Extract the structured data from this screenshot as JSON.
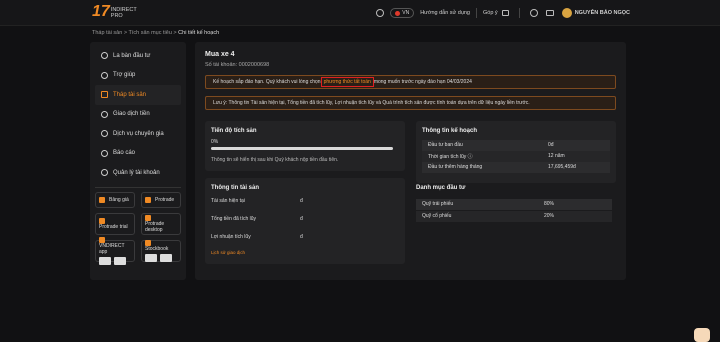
{
  "topbar": {
    "logo_mark": "17",
    "logo_line1": "INDIRECT",
    "logo_line2": "PRO",
    "help_label": "Hướng dẫn sử dụng",
    "language": "VN",
    "feedback_label": "Góp ý",
    "user_name": "NGUYỄN BẢO NGỌC"
  },
  "breadcrumb": {
    "items": [
      "Tháp tài sản",
      "Tích sản mục tiêu"
    ],
    "current": "Chi tiết kế hoạch",
    "separator": ">"
  },
  "sidebar": {
    "items": [
      {
        "label": "La bàn đầu tư",
        "icon": "compass-icon"
      },
      {
        "label": "Trợ giúp",
        "icon": "help-icon"
      },
      {
        "label": "Tháp tài sản",
        "icon": "tower-icon",
        "active": true
      },
      {
        "label": "Giao dịch tiền",
        "icon": "money-icon"
      },
      {
        "label": "Dịch vụ chuyên gia",
        "icon": "expert-icon"
      },
      {
        "label": "Báo cáo",
        "icon": "report-icon"
      },
      {
        "label": "Quản lý tài khoản",
        "icon": "account-icon"
      }
    ],
    "platforms": [
      {
        "label": "Bảng giá"
      },
      {
        "label": "Protrade"
      },
      {
        "label": "Protrade trial"
      },
      {
        "label": "Protrade desktop"
      },
      {
        "label": "VNDIRECT app"
      },
      {
        "label": "Stockbook"
      }
    ]
  },
  "plan": {
    "title": "Mua xe 4",
    "account": "Số tài khoản: 0002000698",
    "alert1_pre": "Kế hoạch sắp đáo hạn. Quý khách vui lòng chọn ",
    "alert1_link": "phương thức tất toán",
    "alert1_post": " mong muốn trước ngày đáo hạn 04/03/2024",
    "alert2": "Lưu ý: Thông tin Tài sản hiện tại, Tổng tiền đã tích lũy, Lợi nhuận tích lũy và Quá trình tích sản được tính toán dựa trên dữ liệu ngày liền trước."
  },
  "progress": {
    "heading": "Tiến độ tích sản",
    "percent_label": "0%",
    "percent_value": 0,
    "note": "Thông tin sẽ hiển thị sau khi Quý khách nộp tiền đầu tiên."
  },
  "asset_info": {
    "heading": "Thông tin tài sản",
    "rows": [
      {
        "label": "Tài sản hiện tại",
        "value": "đ"
      },
      {
        "label": "Tổng tiền đã tích lũy",
        "value": "đ"
      },
      {
        "label": "Lợi nhuận tích lũy",
        "value": "đ"
      }
    ],
    "link": "Lịch sử giao dịch"
  },
  "plan_info": {
    "heading": "Thông tin kế hoạch",
    "rows": [
      {
        "label": "Đầu tư ban đầu",
        "value": "0đ"
      },
      {
        "label": "Thời gian tích lũy ⓘ",
        "value": "12 năm"
      },
      {
        "label": "Đầu tư thêm hàng tháng",
        "value": "17,695,459đ"
      }
    ]
  },
  "portfolio": {
    "heading": "Danh mục đầu tư",
    "rows": [
      {
        "label": "Quỹ trái phiếu",
        "value": "80%"
      },
      {
        "label": "Quỹ cổ phiếu",
        "value": "20%"
      }
    ]
  },
  "colors": {
    "accent": "#f08a24",
    "alert_border": "#7d4a1f",
    "highlight_box": "#e02020"
  }
}
